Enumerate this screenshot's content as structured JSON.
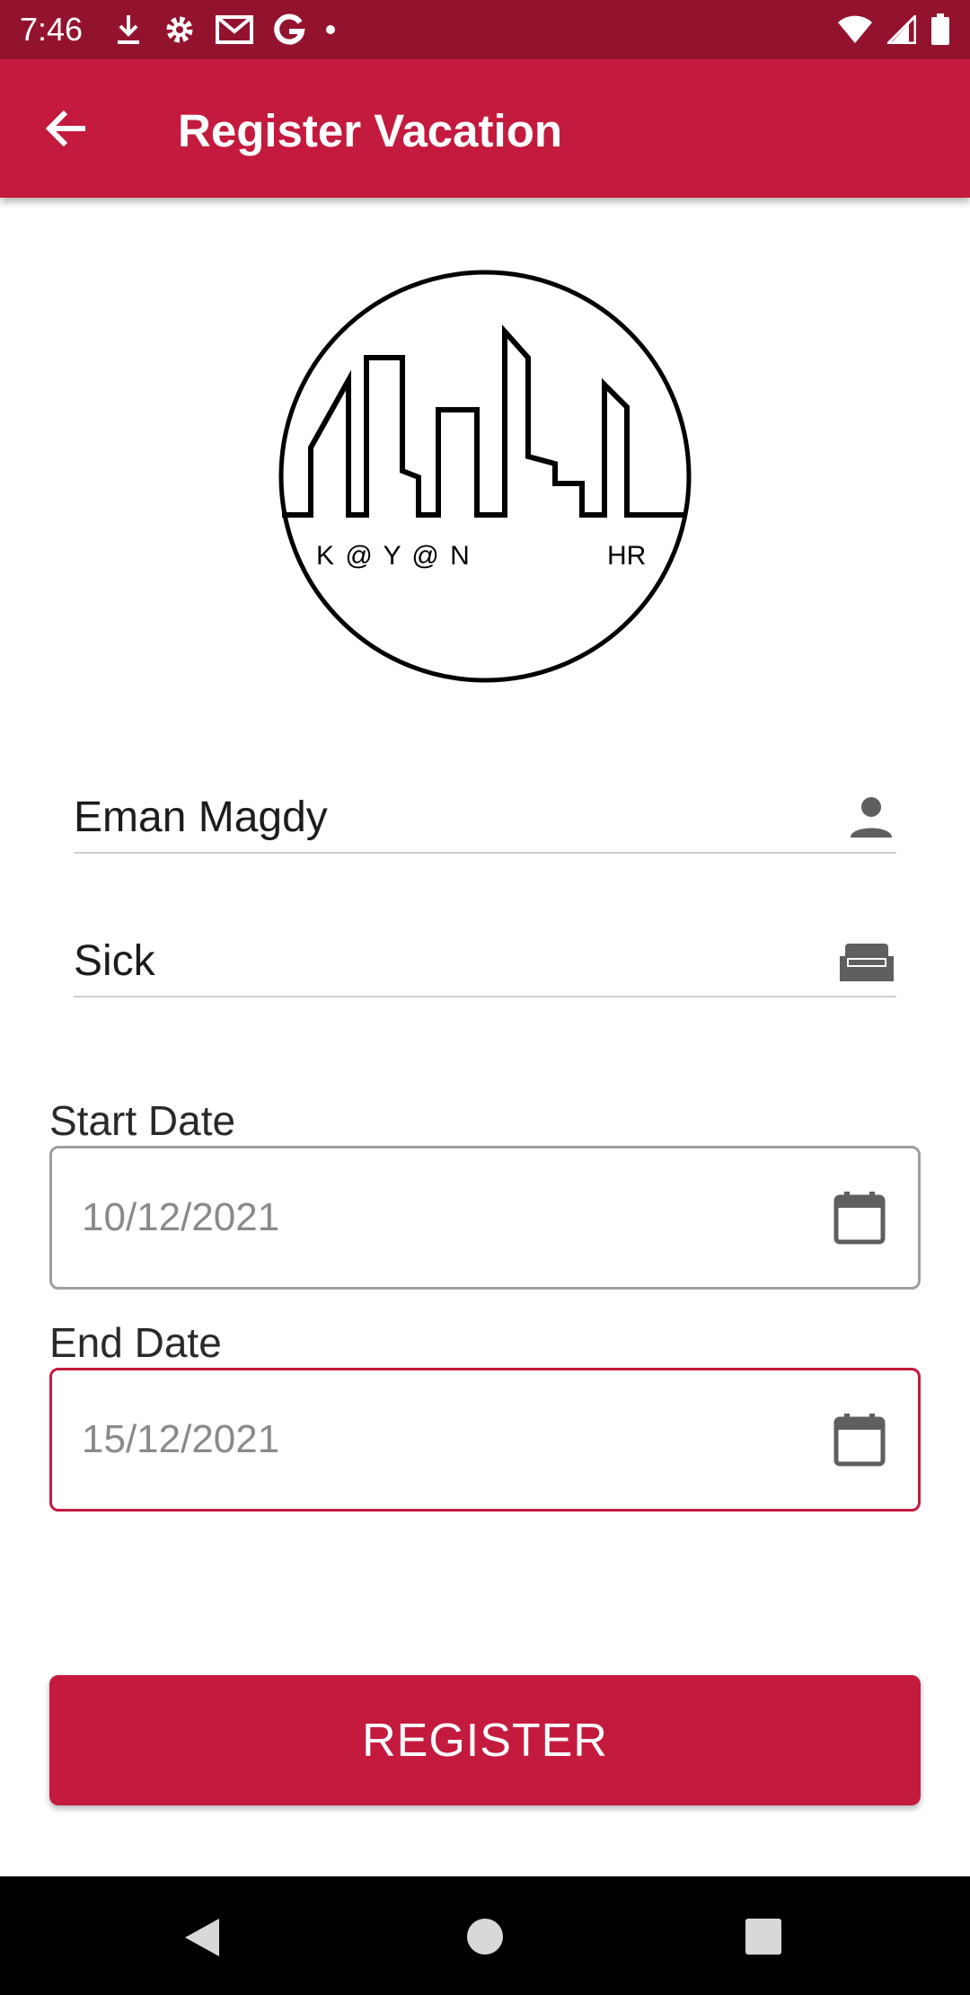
{
  "status_bar": {
    "time": "7:46",
    "left_icons": [
      "download-icon",
      "gear-icon",
      "gmail-icon",
      "google-icon",
      "dot-icon"
    ],
    "right_icons": [
      "wifi-icon",
      "signal-icon",
      "battery-icon"
    ]
  },
  "app_bar": {
    "title": "Register Vacation",
    "back_icon": "arrow-left-icon"
  },
  "logo": {
    "text_left": "K @ Y @ N",
    "text_right": "HR"
  },
  "form": {
    "employee_name": "Eman Magdy",
    "employee_icon": "person-icon",
    "vacation_type": "Sick",
    "vacation_type_icon": "sofa-icon",
    "start_date_label": "Start Date",
    "start_date": "10/12/2021",
    "end_date_label": "End Date",
    "end_date": "15/12/2021",
    "date_icon": "calendar-icon",
    "register_label": "REGISTER"
  },
  "colors": {
    "primary": "#c41a3e",
    "status_bar": "#93132f",
    "nav_bar": "#000000"
  },
  "nav_bar": {
    "buttons": [
      "back-triangle-icon",
      "home-circle-icon",
      "recents-square-icon"
    ]
  }
}
